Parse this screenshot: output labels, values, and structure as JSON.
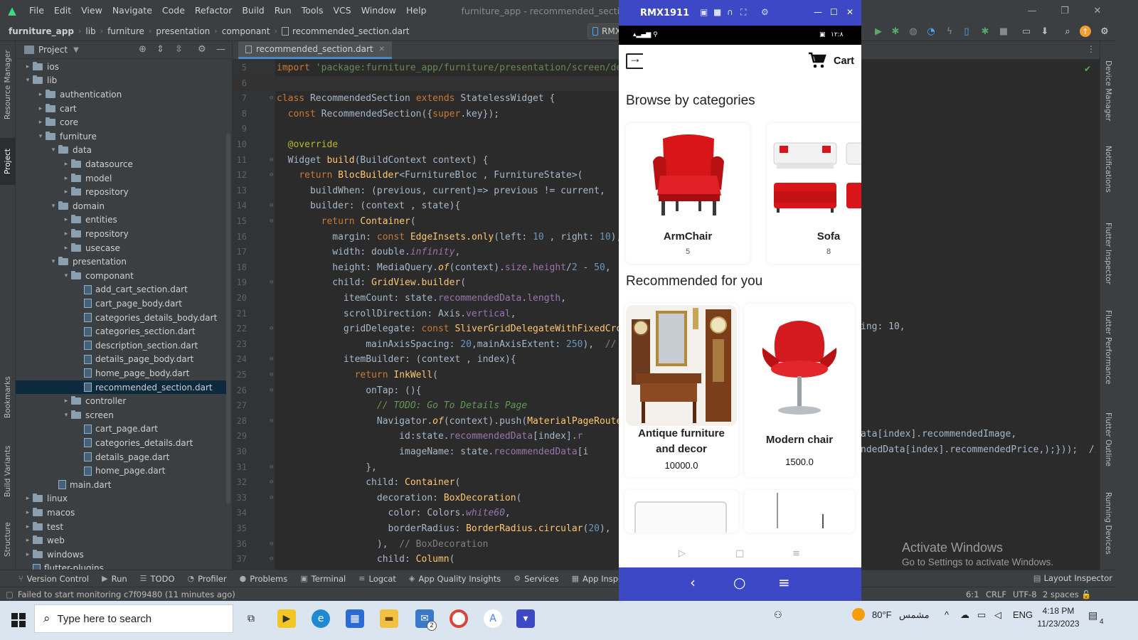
{
  "titlebar": {
    "menu": [
      "File",
      "Edit",
      "View",
      "Navigate",
      "Code",
      "Refactor",
      "Build",
      "Run",
      "Tools",
      "VCS",
      "Window",
      "Help"
    ],
    "window_title": "furniture_app - recommended_section.dart [furniture_app]"
  },
  "breadcrumb": [
    "furniture_app",
    "lib",
    "furniture",
    "presentation",
    "componant",
    "recommended_section.dart"
  ],
  "device_chip": "RMX19",
  "left_strip": [
    "Resource Manager",
    "Project",
    "Bookmarks",
    "Build Variants",
    "Structure"
  ],
  "right_strip": [
    "Device Manager",
    "Notifications",
    "Flutter Inspector",
    "Flutter Performance",
    "Flutter Outline",
    "Running Devices"
  ],
  "project": {
    "header": "Project",
    "tree": [
      {
        "label": "ios",
        "type": "folder",
        "depth": 1,
        "arrow": "▸"
      },
      {
        "label": "lib",
        "type": "folder",
        "depth": 1,
        "arrow": "▾"
      },
      {
        "label": "authentication",
        "type": "folder",
        "depth": 2,
        "arrow": "▸"
      },
      {
        "label": "cart",
        "type": "folder",
        "depth": 2,
        "arrow": "▸"
      },
      {
        "label": "core",
        "type": "folder",
        "depth": 2,
        "arrow": "▸"
      },
      {
        "label": "furniture",
        "type": "folder",
        "depth": 2,
        "arrow": "▾"
      },
      {
        "label": "data",
        "type": "folder",
        "depth": 3,
        "arrow": "▾"
      },
      {
        "label": "datasource",
        "type": "folder",
        "depth": 4,
        "arrow": "▸"
      },
      {
        "label": "model",
        "type": "folder",
        "depth": 4,
        "arrow": "▸"
      },
      {
        "label": "repository",
        "type": "folder",
        "depth": 4,
        "arrow": "▸"
      },
      {
        "label": "domain",
        "type": "folder",
        "depth": 3,
        "arrow": "▾"
      },
      {
        "label": "entities",
        "type": "folder",
        "depth": 4,
        "arrow": "▸"
      },
      {
        "label": "repository",
        "type": "folder",
        "depth": 4,
        "arrow": "▸"
      },
      {
        "label": "usecase",
        "type": "folder",
        "depth": 4,
        "arrow": "▸"
      },
      {
        "label": "presentation",
        "type": "folder",
        "depth": 3,
        "arrow": "▾"
      },
      {
        "label": "componant",
        "type": "folder",
        "depth": 4,
        "arrow": "▾"
      },
      {
        "label": "add_cart_section.dart",
        "type": "file",
        "depth": 5,
        "arrow": ""
      },
      {
        "label": "cart_page_body.dart",
        "type": "file",
        "depth": 5,
        "arrow": ""
      },
      {
        "label": "categories_details_body.dart",
        "type": "file",
        "depth": 5,
        "arrow": ""
      },
      {
        "label": "categories_section.dart",
        "type": "file",
        "depth": 5,
        "arrow": ""
      },
      {
        "label": "description_section.dart",
        "type": "file",
        "depth": 5,
        "arrow": ""
      },
      {
        "label": "details_page_body.dart",
        "type": "file",
        "depth": 5,
        "arrow": ""
      },
      {
        "label": "home_page_body.dart",
        "type": "file",
        "depth": 5,
        "arrow": ""
      },
      {
        "label": "recommended_section.dart",
        "type": "file",
        "depth": 5,
        "arrow": "",
        "selected": true
      },
      {
        "label": "controller",
        "type": "folder",
        "depth": 4,
        "arrow": "▸"
      },
      {
        "label": "screen",
        "type": "folder",
        "depth": 4,
        "arrow": "▾"
      },
      {
        "label": "cart_page.dart",
        "type": "file",
        "depth": 5,
        "arrow": ""
      },
      {
        "label": "categories_details.dart",
        "type": "file",
        "depth": 5,
        "arrow": ""
      },
      {
        "label": "details_page.dart",
        "type": "file",
        "depth": 5,
        "arrow": ""
      },
      {
        "label": "home_page.dart",
        "type": "file",
        "depth": 5,
        "arrow": ""
      },
      {
        "label": "main.dart",
        "type": "file",
        "depth": 3,
        "arrow": ""
      },
      {
        "label": "linux",
        "type": "folder",
        "depth": 1,
        "arrow": "▸"
      },
      {
        "label": "macos",
        "type": "folder",
        "depth": 1,
        "arrow": "▸"
      },
      {
        "label": "test",
        "type": "folder",
        "depth": 1,
        "arrow": "▸"
      },
      {
        "label": "web",
        "type": "folder",
        "depth": 1,
        "arrow": "▸"
      },
      {
        "label": "windows",
        "type": "folder",
        "depth": 1,
        "arrow": "▸"
      },
      {
        "label": "flutter-plugins",
        "type": "file",
        "depth": 1,
        "arrow": ""
      }
    ]
  },
  "editor": {
    "tab_label": "recommended_section.dart",
    "current_line": 6,
    "lines": [
      {
        "n": 5,
        "html": "<span class='kw'>import </span><span class='str'>'package:furniture_app/furniture/presentation/screen/de</span>"
      },
      {
        "n": 6,
        "html": ""
      },
      {
        "n": 7,
        "html": "<span class='kw'>class </span><span class='plain'>RecommendedSection </span><span class='kw'>extends </span><span class='plain'>StatelessWidget {</span>"
      },
      {
        "n": 8,
        "html": "<span class='plain'>  </span><span class='kw'>const </span><span class='plain'>RecommendedSection({</span><span class='kw'>super</span><span class='plain'>.key});</span>"
      },
      {
        "n": 9,
        "html": ""
      },
      {
        "n": 10,
        "html": "<span class='ann'>  @override</span>"
      },
      {
        "n": 11,
        "html": "<span class='plain'>  Widget </span><span class='cls'>build</span><span class='plain'>(BuildContext context) {</span>"
      },
      {
        "n": 12,
        "html": "<span class='plain'>    </span><span class='kw'>return </span><span class='cls'>BlocBuilder</span><span class='plain'>&lt;FurnitureBloc , FurnitureState&gt;(</span>"
      },
      {
        "n": 13,
        "html": "<span class='plain'>      buildWhen: (previous, current)=&gt; previous != current,</span>"
      },
      {
        "n": 14,
        "html": "<span class='plain'>      builder: (context , state){</span>"
      },
      {
        "n": 15,
        "html": "<span class='plain'>        </span><span class='kw'>return </span><span class='cls'>Container</span><span class='plain'>(</span>"
      },
      {
        "n": 16,
        "html": "<span class='plain'>          margin: </span><span class='kw'>const </span><span class='cls'>EdgeInsets.only</span><span class='plain'>(left: </span><span class='num'>10</span><span class='plain'> , right: </span><span class='num'>10</span><span class='plain'>),</span>"
      },
      {
        "n": 17,
        "html": "<span class='plain'>          width: double.</span><span class='fld' style='font-style:italic'>infinity</span><span class='plain'>,</span>"
      },
      {
        "n": 18,
        "html": "<span class='plain'>          height: MediaQuery.</span><span class='cls' style='font-style:italic'>of</span><span class='plain'>(context).</span><span class='fld'>size</span><span class='plain'>.</span><span class='fld'>height</span><span class='plain'>/</span><span class='num'>2</span><span class='plain'> - </span><span class='num'>50</span><span class='plain'>,</span>"
      },
      {
        "n": 19,
        "html": "<span class='plain'>          child: </span><span class='cls'>GridView.builder</span><span class='plain'>(</span>"
      },
      {
        "n": 20,
        "html": "<span class='plain'>            itemCount: state.</span><span class='fld'>recommendedData</span><span class='plain'>.</span><span class='fld'>length</span><span class='plain'>,</span>"
      },
      {
        "n": 21,
        "html": "<span class='plain'>            scrollDirection: Axis.</span><span class='fld'>vertical</span><span class='plain'>,</span>"
      },
      {
        "n": 22,
        "html": "<span class='plain'>            gridDelegate: </span><span class='kw'>const </span><span class='cls'>SliverGridDelegateWithFixedCro</span>"
      },
      {
        "n": 23,
        "html": "<span class='plain'>                mainAxisSpacing: </span><span class='num'>20</span><span class='plain'>,mainAxisExtent: </span><span class='num'>250</span><span class='plain'>),  </span><span class='cmt2'>//</span>"
      },
      {
        "n": 24,
        "html": "<span class='plain'>            itemBuilder: (context , index){</span>"
      },
      {
        "n": 25,
        "html": "<span class='plain'>              </span><span class='kw'>return </span><span class='cls'>InkWell</span><span class='plain'>(</span>"
      },
      {
        "n": 26,
        "html": "<span class='plain'>                onTap: (){</span>"
      },
      {
        "n": 27,
        "html": "<span class='cmt'>                  // TODO: Go To Details Page</span>"
      },
      {
        "n": 28,
        "html": "<span class='plain'>                  Navigator.</span><span class='cls' style='font-style:italic'>of</span><span class='plain'>(context).push(</span><span class='cls'>MaterialPageRoute</span>"
      },
      {
        "n": 29,
        "html": "<span class='plain'>                      id:state.</span><span class='fld'>recommendedData</span><span class='plain'>[index].</span><span class='fld'>r</span>"
      },
      {
        "n": 30,
        "html": "<span class='plain'>                      imageName: state.</span><span class='fld'>recommendedData</span><span class='plain'>[i</span>"
      },
      {
        "n": 31,
        "html": "<span class='plain'>                },</span>"
      },
      {
        "n": 32,
        "html": "<span class='plain'>                child: </span><span class='cls'>Container</span><span class='plain'>(</span>"
      },
      {
        "n": 33,
        "html": "<span class='plain'>                  decoration: </span><span class='cls'>BoxDecoration</span><span class='plain'>(</span>"
      },
      {
        "n": 34,
        "html": "<span class='plain'>                    color: Colors.</span><span class='fld' style='font-style:italic'>white60</span><span class='plain'>,</span>"
      },
      {
        "n": 35,
        "html": "<span class='plain'>                    borderRadius: </span><span class='cls'>BorderRadius.circular</span><span class='plain'>(</span><span class='num'>20</span><span class='plain'>),</span>"
      },
      {
        "n": 36,
        "html": "<span class='plain'>                  ),  </span><span class='cmt2'>// BoxDecoration</span>"
      },
      {
        "n": 37,
        "html": "<span class='plain'>                  child: </span><span class='cls'>Column</span><span class='plain'>(</span>"
      }
    ],
    "right_fragments": [
      {
        "line": 22,
        "text": "ing: 10,"
      },
      {
        "line": 29,
        "text": "ata[index].recommendedImage,"
      },
      {
        "line": 30,
        "text": "ndedData[index].recommendedPrice,);}));  //"
      }
    ]
  },
  "emulator": {
    "device_name": "RMX1911",
    "status_time": "١٢:٨",
    "app": {
      "cart_label": "Cart",
      "categories_title": "Browse by categories",
      "categories": [
        {
          "name": "ArmChair",
          "count": "5"
        },
        {
          "name": "Sofa",
          "count": "8"
        }
      ],
      "recommended_title": "Recommended for you",
      "recommended": [
        {
          "name": "Antique furniture and decor",
          "price": "10000.0"
        },
        {
          "name": "Modern chair",
          "price": "1500.0"
        }
      ]
    }
  },
  "activate_windows": {
    "title": "Activate Windows",
    "subtitle": "Go to Settings to activate Windows."
  },
  "bottom_tools": [
    "Version Control",
    "Run",
    "TODO",
    "Profiler",
    "Problems",
    "Terminal",
    "Logcat",
    "App Quality Insights",
    "Services",
    "App Inspe"
  ],
  "layout_inspector": "Layout Inspector",
  "status": {
    "message": "Failed to start monitoring c7f09480 (11 minutes ago)",
    "position": "6:1",
    "line_sep": "CRLF",
    "encoding": "UTF-8",
    "indent": "2 spaces"
  },
  "taskbar": {
    "search_placeholder": "Type here to search",
    "weather": "80°F",
    "weather_text": "مشمس",
    "lang": "ENG",
    "time": "4:18 PM",
    "date": "11/23/2023",
    "notif_count": "4",
    "badge": "2"
  }
}
